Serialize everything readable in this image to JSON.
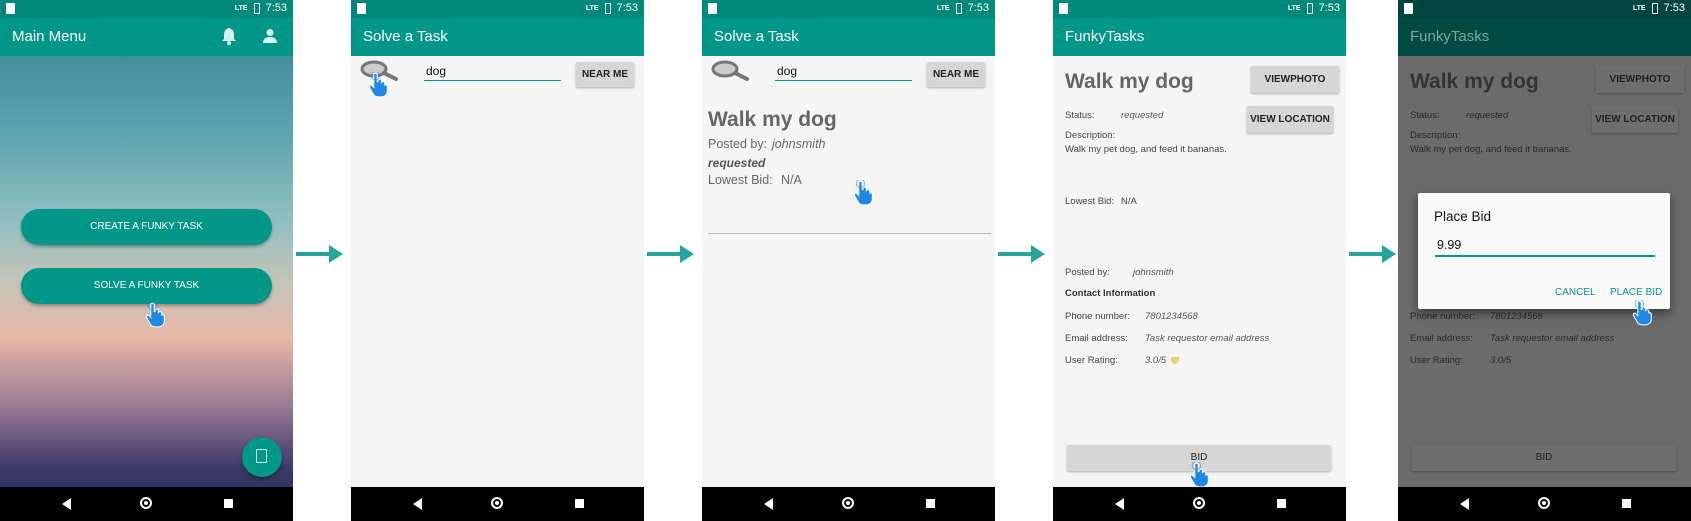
{
  "status": {
    "time": "7:53",
    "network": "LTE"
  },
  "screen1": {
    "title": "Main Menu",
    "create_button": "CREATE A FUNKY TASK",
    "solve_button": "SOLVE A FUNKY TASK"
  },
  "screen2": {
    "title": "Solve a Task",
    "search_value": "dog",
    "near_me": "NEAR ME"
  },
  "screen3": {
    "title": "Solve a Task",
    "search_value": "dog",
    "near_me": "NEAR ME",
    "task": {
      "title": "Walk my dog",
      "posted_by_label": "Posted by:",
      "posted_by": "johnsmith",
      "status": "requested",
      "lowest_bid_label": "Lowest Bid:",
      "lowest_bid": "N/A"
    }
  },
  "screen4": {
    "app_title": "FunkyTasks",
    "task_title": "Walk my dog",
    "view_photo": "VIEWPHOTO",
    "view_location": "VIEW LOCATION",
    "status_label": "Status:",
    "status": "requested",
    "description_label": "Description:",
    "description": "Walk my pet dog, and feed it bananas.",
    "lowest_bid_label": "Lowest Bid:",
    "lowest_bid": "N/A",
    "posted_by_label": "Posted by:",
    "posted_by": "johnsmith",
    "contact_header": "Contact Information",
    "phone_label": "Phone number:",
    "phone": "7801234568",
    "email_label": "Email address:",
    "email": "Task requestor email address",
    "rating_label": "User Rating:",
    "rating": "3.0/5",
    "bid_button": "BID"
  },
  "screen5": {
    "dialog_title": "Place Bid",
    "bid_value": "9.99",
    "cancel": "CANCEL",
    "place_bid": "PLACE BID"
  },
  "colors": {
    "primary": "#009688",
    "arrow": "#26a69a",
    "touch": "#1e88e5"
  }
}
